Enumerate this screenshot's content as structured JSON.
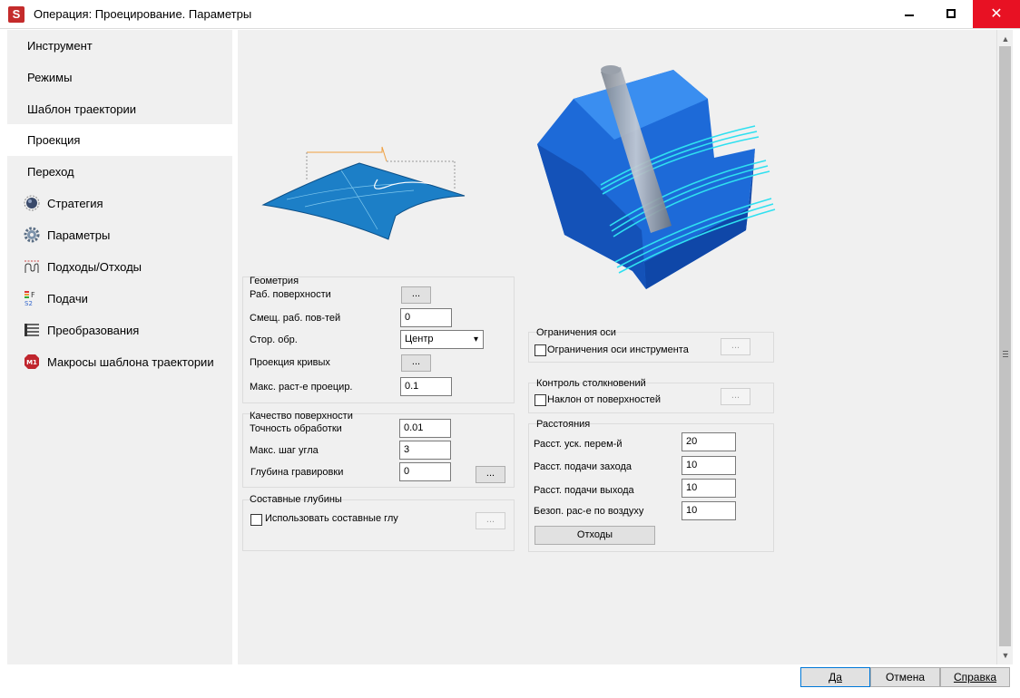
{
  "window": {
    "title": "Операция: Проецирование. Параметры",
    "app_icon_letter": "S"
  },
  "sidebar": {
    "items": [
      {
        "label": "Инструмент"
      },
      {
        "label": "Режимы"
      },
      {
        "label": "Шаблон траектории"
      },
      {
        "label": "Проекция"
      },
      {
        "label": "Переход"
      },
      {
        "label": "Стратегия",
        "icon": "sphere-icon"
      },
      {
        "label": "Параметры",
        "icon": "gear-icon"
      },
      {
        "label": "Подходы/Отходы",
        "icon": "approach-icon"
      },
      {
        "label": "Подачи",
        "icon": "feed-icon"
      },
      {
        "label": "Преобразования",
        "icon": "transform-icon"
      },
      {
        "label": "Макросы шаблона траектории",
        "icon": "macro-icon",
        "icon_text": "M1"
      }
    ],
    "active_index": 3
  },
  "geometry": {
    "title": "Геометрия",
    "work_surfaces_label": "Раб. поверхности",
    "offset_label": "Смещ. раб. пов-тей",
    "offset_value": "0",
    "side_label": "Стор. обр.",
    "side_value": "Центр",
    "curves_label": "Проекция кривых",
    "max_dist_label": "Макс. раст-е проецир.",
    "max_dist_value": "0.1"
  },
  "quality": {
    "title": "Качество поверхности",
    "accuracy_label": "Точность обработки",
    "accuracy_value": "0.01",
    "angle_label": "Макс. шаг угла",
    "angle_value": "3",
    "engrave_label": "Глубина гравировки",
    "engrave_value": "0"
  },
  "composite": {
    "title": "Составные глубины",
    "use_label": "Использовать составные глу"
  },
  "axis_limits": {
    "title": "Ограничения оси",
    "tool_label": "Ограничения оси инструмента"
  },
  "collision": {
    "title": "Контроль столкновений",
    "tilt_label": "Наклон от поверхностей"
  },
  "distances": {
    "title": "Расстояния",
    "rapid_label": "Расст. уск. перем-й",
    "rapid_value": "20",
    "approach_label": "Расст. подачи захода",
    "approach_value": "10",
    "retract_label": "Расст. подачи выхода",
    "retract_value": "10",
    "safe_label": "Безоп. рас-е по воздуху",
    "safe_value": "10",
    "retracts_button": "Отходы"
  },
  "common": {
    "dots": "..."
  },
  "footer": {
    "ok": "Да",
    "cancel": "Отмена",
    "help": "Справка"
  },
  "colors": {
    "accent_blue": "#1e6fd9",
    "toolpath_cyan": "#2fe0f0",
    "close_red": "#e81123"
  }
}
